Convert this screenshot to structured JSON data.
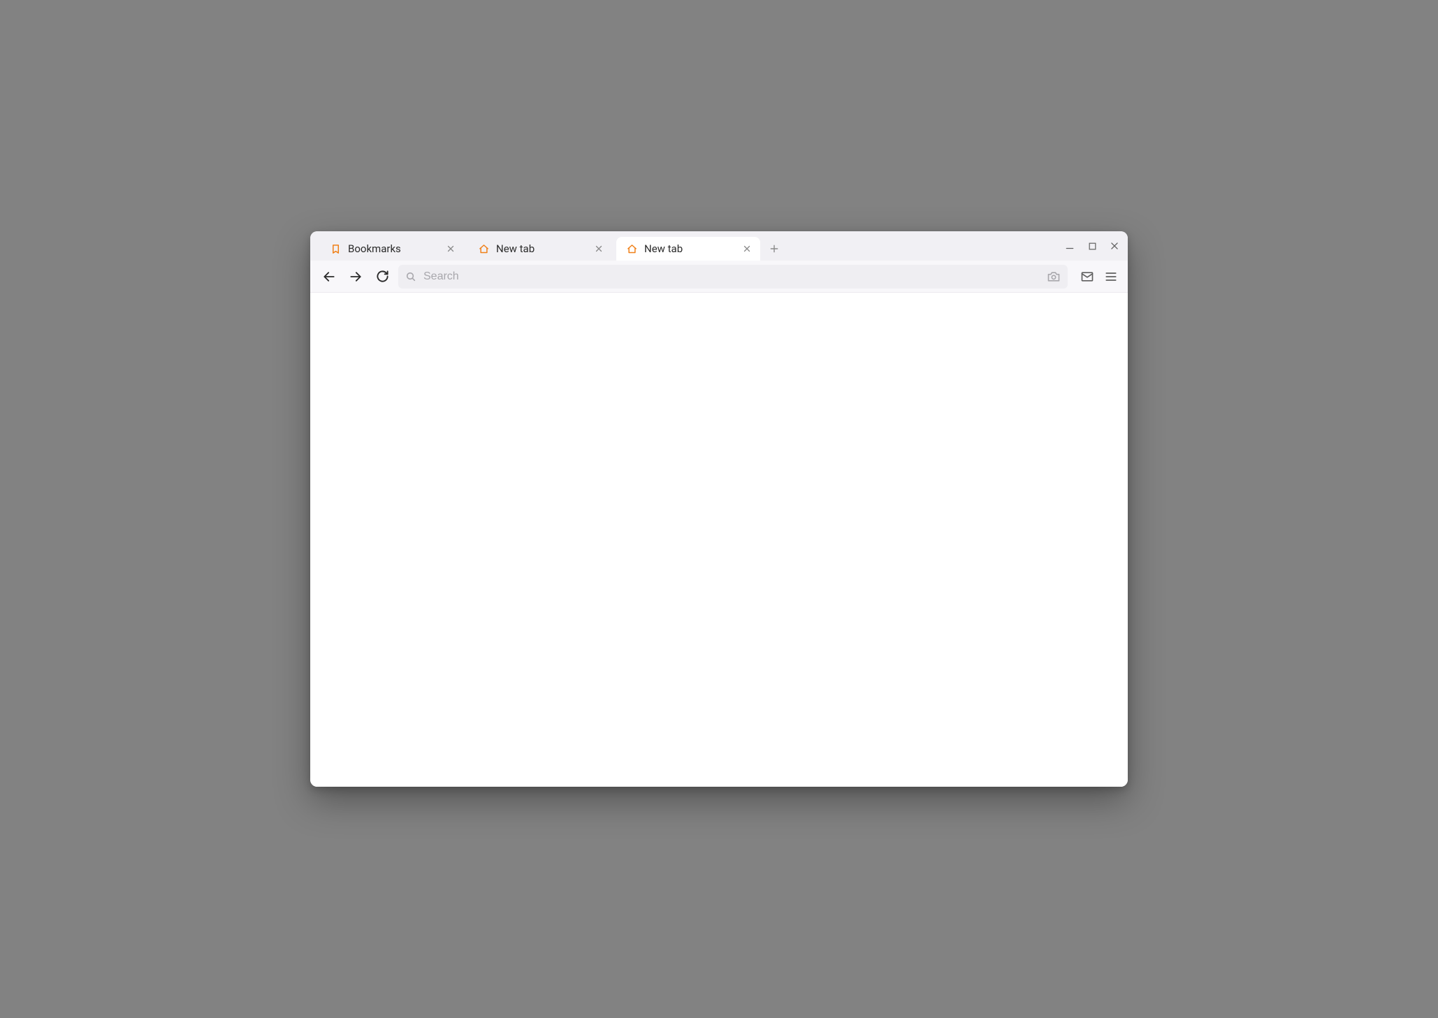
{
  "tabs": [
    {
      "label": "Bookmarks",
      "icon": "bookmark-icon",
      "active": false
    },
    {
      "label": "New tab",
      "icon": "home-icon",
      "active": false
    },
    {
      "label": "New tab",
      "icon": "home-icon",
      "active": true
    }
  ],
  "addressbar": {
    "placeholder": "Search",
    "value": ""
  },
  "colors": {
    "accent": "#f08018",
    "tabstrip_bg": "#f1f0f4",
    "toolbar_bg": "#f8f7fa",
    "addressbar_bg": "#efeef2"
  }
}
